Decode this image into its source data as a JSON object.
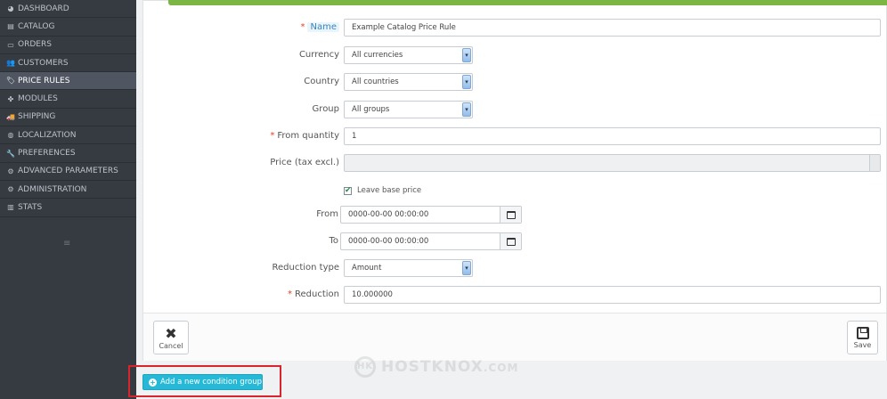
{
  "sidebar": {
    "items": [
      {
        "label": "DASHBOARD",
        "icon": "dashboard-icon",
        "glyph": "◕"
      },
      {
        "label": "CATALOG",
        "icon": "catalog-icon",
        "glyph": "▤"
      },
      {
        "label": "ORDERS",
        "icon": "orders-icon",
        "glyph": "▭"
      },
      {
        "label": "CUSTOMERS",
        "icon": "customers-icon",
        "glyph": "👥"
      },
      {
        "label": "PRICE RULES",
        "icon": "tags-icon",
        "glyph": "🏷"
      },
      {
        "label": "MODULES",
        "icon": "puzzle-icon",
        "glyph": "✤"
      },
      {
        "label": "SHIPPING",
        "icon": "truck-icon",
        "glyph": "🚚"
      },
      {
        "label": "LOCALIZATION",
        "icon": "globe-icon",
        "glyph": "◍"
      },
      {
        "label": "PREFERENCES",
        "icon": "wrench-icon",
        "glyph": "🔧"
      },
      {
        "label": "ADVANCED PARAMETERS",
        "icon": "cogs-icon",
        "glyph": "⚙"
      },
      {
        "label": "ADMINISTRATION",
        "icon": "cog-icon",
        "glyph": "⚙"
      },
      {
        "label": "STATS",
        "icon": "bar-chart-icon",
        "glyph": "▥"
      }
    ],
    "collapse_glyph": "≡"
  },
  "form": {
    "name": {
      "label": "Name",
      "value": "Example Catalog Price Rule"
    },
    "currency": {
      "label": "Currency",
      "value": "All currencies"
    },
    "country": {
      "label": "Country",
      "value": "All countries"
    },
    "group": {
      "label": "Group",
      "value": "All groups"
    },
    "from_quantity": {
      "label": "From quantity",
      "value": "1"
    },
    "price": {
      "label": "Price (tax excl.)",
      "value": ""
    },
    "leave_base_price": {
      "label": "Leave base price",
      "checked": true
    },
    "from": {
      "label": "From",
      "value": "0000-00-00 00:00:00"
    },
    "to": {
      "label": "To",
      "value": "0000-00-00 00:00:00"
    },
    "reduction_type": {
      "label": "Reduction type",
      "value": "Amount"
    },
    "reduction": {
      "label": "Reduction",
      "value": "10.000000"
    },
    "required_mark": "*"
  },
  "footer": {
    "cancel_label": "Cancel",
    "save_label": "Save"
  },
  "add_condition_label": "Add a new condition group",
  "watermark": {
    "logo": "HK",
    "text": "HOSTKNOX",
    "domain": ".COM"
  },
  "colors": {
    "sidebar_bg": "#363a41",
    "accent_green": "#7bb543",
    "primary_blue": "#25b9d7",
    "highlight_red": "#d9232d",
    "required_red": "#e0412b"
  }
}
